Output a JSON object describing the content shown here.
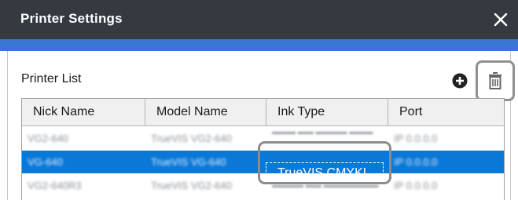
{
  "window": {
    "title": "Printer Settings",
    "close_icon": "close-icon"
  },
  "colors": {
    "titlebar": "#343a40",
    "accent": "#3a74d4",
    "selection": "#0a78d7",
    "highlight_border": "#8c8c8c"
  },
  "printer_list": {
    "label": "Printer List",
    "add_icon": "plus-circle-icon",
    "delete_icon": "trash-icon",
    "columns": [
      "Nick Name",
      "Model Name",
      "Ink Type",
      "Port"
    ],
    "rows": [
      {
        "nick": "VG2-640",
        "model": "TrueVIS VG2-640",
        "ink": "",
        "port": "IP 0.0.0.0",
        "selected": false
      },
      {
        "nick": "VG-640",
        "model": "TrueVIS VG-640",
        "ink": "TrueVIS CMYKL...",
        "port": "IP 0.0.0.0",
        "selected": true
      },
      {
        "nick": "VG2-640R3",
        "model": "TrueVIS VG2-640",
        "ink": "",
        "port": "IP 0.0.0.0",
        "selected": false
      }
    ]
  }
}
